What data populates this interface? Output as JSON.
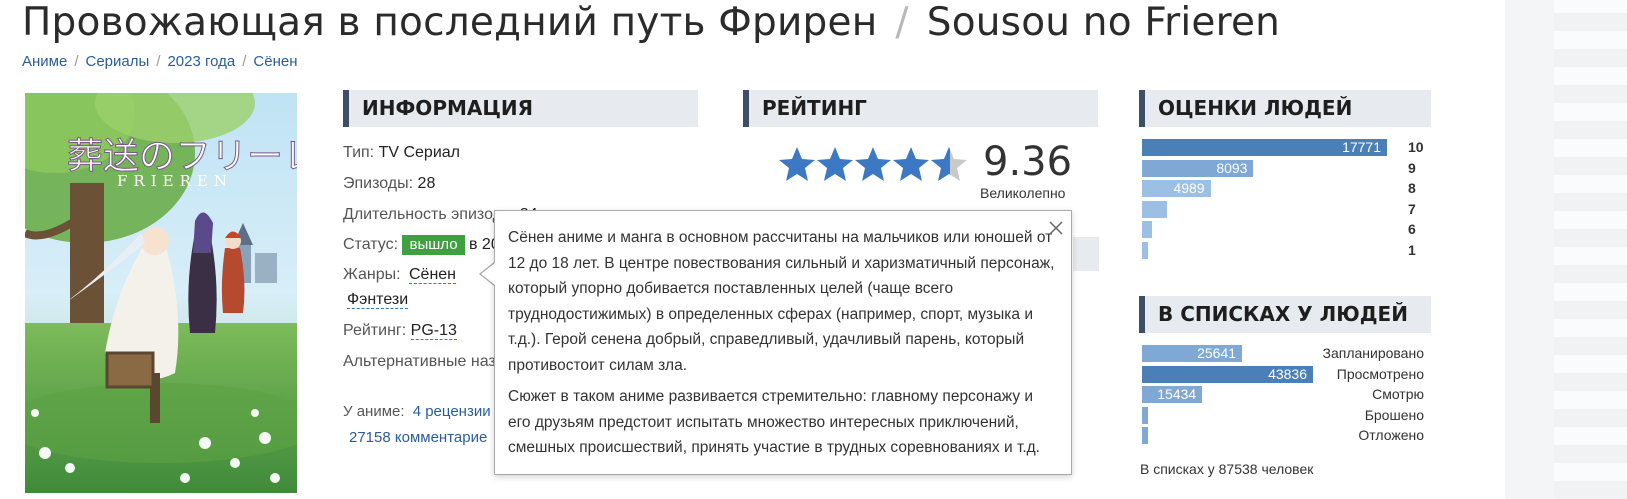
{
  "title": {
    "ru": "Провожающая в последний путь Фрирен",
    "separator": "/",
    "en": "Sousou no Frieren"
  },
  "breadcrumbs": [
    "Аниме",
    "Сериалы",
    "2023 года",
    "Сёнен"
  ],
  "poster": {
    "logo_text": "葬送のフリーレン",
    "logo_sub": "FRIEREN"
  },
  "info": {
    "heading": "ИНФОРМАЦИЯ",
    "type_label": "Тип:",
    "type_value": "TV Сериал",
    "episodes_label": "Эпизоды:",
    "episodes_value": "28",
    "duration_label": "Длительность эпизода:",
    "duration_value": "24",
    "status_label": "Статус:",
    "status_badge": "вышло",
    "status_after": "в 20",
    "genres_label": "Жанры:",
    "genre_1": "Сёнен",
    "genre_2": "Фэнтези",
    "rating_label": "Рейтинг:",
    "rating_value": "PG-13",
    "alt_names_label": "Альтернативные наз",
    "reviews_label": "У аниме:",
    "reviews_link": "4 рецензии",
    "comments_link": "27158 комментарие"
  },
  "rating": {
    "heading": "РЕЙТИНГ",
    "score": "9.36",
    "stars_fraction": 0.936,
    "word": "Великолепно"
  },
  "people_scores": {
    "heading": "ОЦЕНКИ ЛЮДЕЙ",
    "rows": [
      {
        "score": "10",
        "count": "17771",
        "fraction": 1.0
      },
      {
        "score": "9",
        "count": "8093",
        "fraction": 0.455
      },
      {
        "score": "8",
        "count": "4989",
        "fraction": 0.28
      },
      {
        "score": "7",
        "count": "",
        "fraction": 0.1
      },
      {
        "score": "6",
        "count": "",
        "fraction": 0.04
      },
      {
        "score": "1",
        "count": "",
        "fraction": 0.02
      }
    ]
  },
  "people_lists": {
    "heading": "В СПИСКАХ У ЛЮДЕЙ",
    "rows": [
      {
        "label": "Запланировано",
        "count": "25641",
        "fraction": 0.585
      },
      {
        "label": "Просмотрено",
        "count": "43836",
        "fraction": 1.0
      },
      {
        "label": "Смотрю",
        "count": "15434",
        "fraction": 0.352
      },
      {
        "label": "Брошено",
        "count": "",
        "fraction": 0.03
      },
      {
        "label": "Отложено",
        "count": "",
        "fraction": 0.025
      }
    ],
    "total": "В списках у 87538 человек"
  },
  "tooltip": {
    "p1": "Сёнен аниме и манга в основном рассчитаны на мальчиков или юношей от 12 до 18 лет. В центре повествования сильный и харизматичный персонаж, который упорно добивается поставленных целей (чаще всего труднодостижимых) в определенных сферах (например, спорт, музыка и т.д.). Герой сенена добрый, справедливый, удачливый парень, который противостоит силам зла.",
    "p2": "Сюжет в таком аниме развивается стремительно: главному персонажу и его друзьям предстоит испытать множество интересных приключений, смешных происшествий, принять участие в трудных соревнованиях и т.д."
  },
  "colors": {
    "bar_top": "#4a80b7",
    "bar_mid": "#7fa9d4",
    "bar_light": "#9cc0e3",
    "status_green": "#3ea03e",
    "star_blue": "#3c78c4",
    "star_gray": "#c9c9c9"
  }
}
